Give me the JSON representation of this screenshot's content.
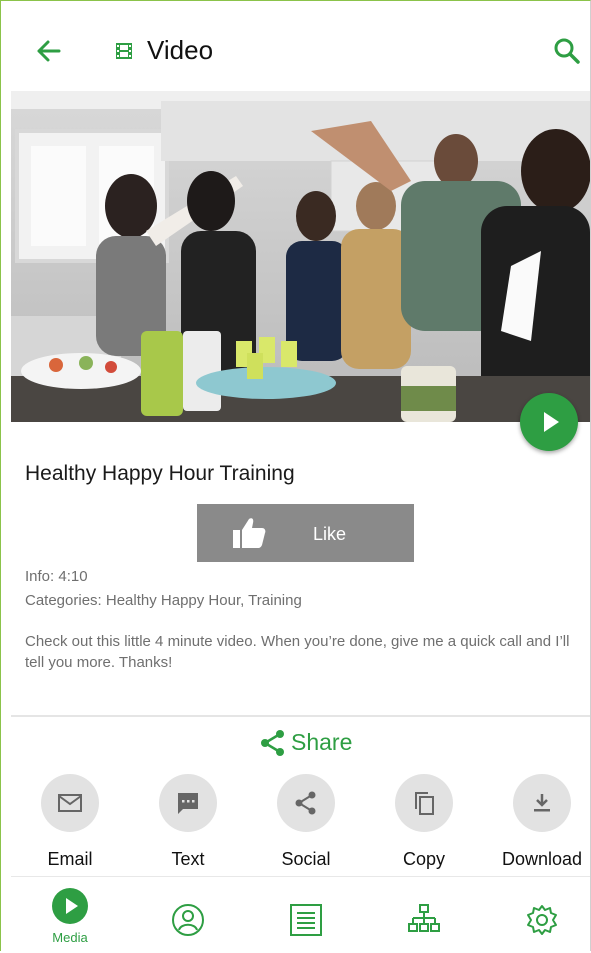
{
  "header": {
    "title": "Video",
    "back_icon": "arrow-left-icon",
    "title_icon": "film-icon",
    "search_icon": "search-icon"
  },
  "colors": {
    "accent": "#2e9e43",
    "like_bg": "#8a8a8a",
    "action_circle": "#e2e2e2",
    "text_muted": "#6f6f6f"
  },
  "video": {
    "title": "Healthy Happy Hour Training",
    "like_label": "Like",
    "info": "Info: 4:10",
    "categories": "Categories: Healthy Happy Hour, Training",
    "description": "Check out this little 4 minute video. When you’re done, give me a quick call and I’ll tell you more. Thanks!"
  },
  "share": {
    "label": "Share",
    "icon": "share-icon"
  },
  "actions": [
    {
      "label": "Email",
      "icon": "email-icon"
    },
    {
      "label": "Text",
      "icon": "message-icon"
    },
    {
      "label": "Social",
      "icon": "share-icon"
    },
    {
      "label": "Copy",
      "icon": "copy-icon"
    },
    {
      "label": "Download",
      "icon": "download-icon"
    }
  ],
  "bottom_nav": [
    {
      "label": "Media",
      "icon": "play-circle-icon",
      "active": true
    },
    {
      "label": "",
      "icon": "contacts-icon",
      "active": false
    },
    {
      "label": "",
      "icon": "list-icon",
      "active": false
    },
    {
      "label": "",
      "icon": "org-chart-icon",
      "active": false
    },
    {
      "label": "",
      "icon": "settings-icon",
      "active": false
    }
  ]
}
